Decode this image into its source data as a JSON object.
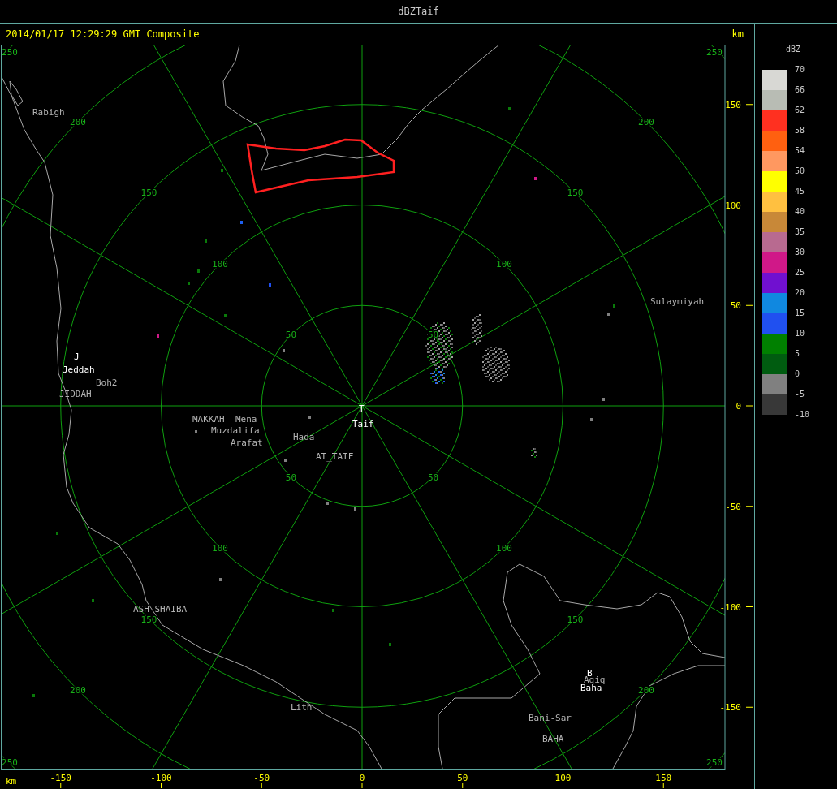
{
  "window": {
    "title": "dBZTaif"
  },
  "header": {
    "caption": "2014/01/17 12:29:29 GMT Composite",
    "unit": "km"
  },
  "map": {
    "ring_labels": [
      "50",
      "50",
      "50",
      "50",
      "100",
      "100",
      "100",
      "100",
      "150",
      "150",
      "150",
      "150",
      "200",
      "200",
      "200",
      "200",
      "250",
      "250",
      "250",
      "250"
    ],
    "places": [
      {
        "label": "Rabigh",
        "kind": "place"
      },
      {
        "label": "J",
        "kind": "radar"
      },
      {
        "label": "Jeddah",
        "kind": "radar"
      },
      {
        "label": "Boh2",
        "kind": "place"
      },
      {
        "label": "JIDDAH",
        "kind": "place"
      },
      {
        "label": "MAKKAH",
        "kind": "place"
      },
      {
        "label": "Mena",
        "kind": "place"
      },
      {
        "label": "Muzdalifa",
        "kind": "place"
      },
      {
        "label": "Arafat",
        "kind": "place"
      },
      {
        "label": "Hada",
        "kind": "place"
      },
      {
        "label": "T",
        "kind": "radar"
      },
      {
        "label": "Taif",
        "kind": "radar"
      },
      {
        "label": "AT_TAIF",
        "kind": "place"
      },
      {
        "label": "Sulaymiyah",
        "kind": "place"
      },
      {
        "label": "ASH_SHAIBA",
        "kind": "place"
      },
      {
        "label": "Lith",
        "kind": "place"
      },
      {
        "label": "B",
        "kind": "radar"
      },
      {
        "label": "Aqiq",
        "kind": "place"
      },
      {
        "label": "Baha",
        "kind": "radar"
      },
      {
        "label": "Bani-Sar",
        "kind": "place"
      },
      {
        "label": "BAHA",
        "kind": "place"
      }
    ]
  },
  "y_axis": {
    "ticks": [
      "150",
      "100",
      "50",
      "0",
      "-50",
      "-100",
      "-150"
    ]
  },
  "x_axis": {
    "unit": "km",
    "ticks": [
      "-150",
      "-100",
      "-50",
      "0",
      "50",
      "100",
      "150"
    ]
  },
  "legend": {
    "unit": "dBZ",
    "bottom_label": "-10",
    "bins": [
      {
        "label": "70",
        "color": "#d8d8d4"
      },
      {
        "label": "66",
        "color": "#b8bcb4"
      },
      {
        "label": "62",
        "color": "#ff3020"
      },
      {
        "label": "58",
        "color": "#ff6010"
      },
      {
        "label": "54",
        "color": "#ff9860"
      },
      {
        "label": "50",
        "color": "#ffff00"
      },
      {
        "label": "45",
        "color": "#ffc040"
      },
      {
        "label": "40",
        "color": "#c88838"
      },
      {
        "label": "35",
        "color": "#b86a90"
      },
      {
        "label": "30",
        "color": "#d01888"
      },
      {
        "label": "25",
        "color": "#7010d0"
      },
      {
        "label": "20",
        "color": "#1088e0"
      },
      {
        "label": "15",
        "color": "#2050f0"
      },
      {
        "label": "10",
        "color": "#008000"
      },
      {
        "label": "5",
        "color": "#005c10"
      },
      {
        "label": "0",
        "color": "#808080"
      },
      {
        "label": "-5",
        "color": "#383838"
      }
    ]
  }
}
